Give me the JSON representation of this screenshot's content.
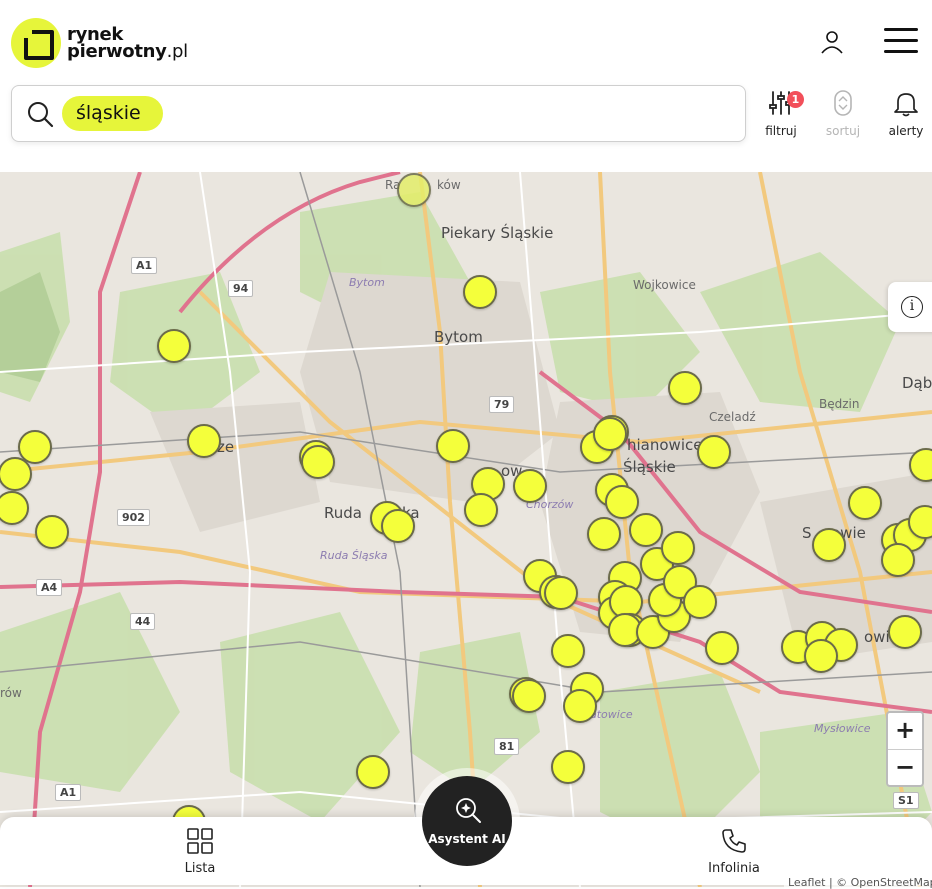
{
  "brand": {
    "line1": "rynek",
    "line2_bold": "pierwotny",
    "line2_suffix": ".pl"
  },
  "header": {
    "user_icon": "user-icon",
    "menu_icon": "hamburger-icon"
  },
  "search": {
    "icon": "search-icon",
    "chip_label": "śląskie"
  },
  "toolbar": {
    "filter": {
      "label": "filtruj",
      "badge": "1",
      "icon": "sliders-icon"
    },
    "sort": {
      "label": "sortuj",
      "icon": "sort-icon",
      "disabled": true
    },
    "alerts": {
      "label": "alerty",
      "icon": "bell-icon"
    }
  },
  "map": {
    "labels": [
      {
        "id": "piekary",
        "text": "Piekary Śląskie"
      },
      {
        "id": "bytom",
        "text": "Bytom"
      },
      {
        "id": "bytom-it",
        "text": "Bytom"
      },
      {
        "id": "wojkowice",
        "text": "Wojkowice"
      },
      {
        "id": "czeladz",
        "text": "Czeladź"
      },
      {
        "id": "bedzin",
        "text": "Będzin"
      },
      {
        "id": "siemianowice1",
        "text": "hianowice"
      },
      {
        "id": "siemianowice2",
        "text": "Śląskie"
      },
      {
        "id": "ruda",
        "text": "Ruda"
      },
      {
        "id": "ruda2",
        "text": "ka"
      },
      {
        "id": "ruda-it",
        "text": "Ruda Śląska"
      },
      {
        "id": "zabrze",
        "text": "ze"
      },
      {
        "id": "chorzow",
        "text": "Chorzów"
      },
      {
        "id": "chorzow2",
        "text": "ow"
      },
      {
        "id": "sosnowiec",
        "text": "S"
      },
      {
        "id": "sosnowiec2",
        "text": "owie"
      },
      {
        "id": "dab",
        "text": "Dąb"
      },
      {
        "id": "katowice",
        "text": "atowice"
      },
      {
        "id": "myslowice",
        "text": "Mysłowice"
      },
      {
        "id": "radzionkow",
        "text": "Ra"
      },
      {
        "id": "radzionkow2",
        "text": "ków"
      },
      {
        "id": "owice",
        "text": "owic"
      },
      {
        "id": "gierow",
        "text": "rów"
      }
    ],
    "roads": [
      "A1",
      "94",
      "79",
      "902",
      "A4",
      "44",
      "81",
      "A1",
      "S1"
    ],
    "info_icon": "info-icon",
    "zoom_in": "+",
    "zoom_out": "−",
    "attribution": "Leaflet | © OpenStreetMap"
  },
  "bottom_nav": {
    "list": {
      "label": "Lista",
      "icon": "grid-icon"
    },
    "assistant": {
      "label": "Asystent AI",
      "icon": "ai-search-icon"
    },
    "phone": {
      "label": "Infolinia",
      "icon": "phone-icon"
    }
  },
  "colors": {
    "brand_yellow": "#e6f53a",
    "pin_yellow": "#f4ff3b",
    "badge_red": "#f24f5a"
  }
}
